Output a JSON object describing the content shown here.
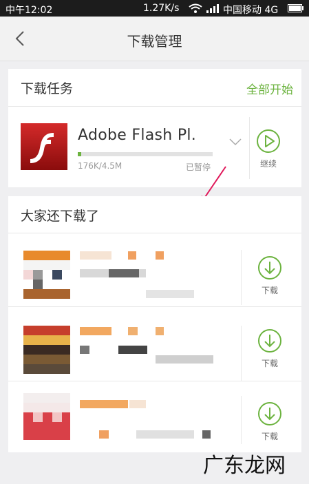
{
  "status_bar": {
    "time": "中午12:02",
    "speed": "1.27K/s",
    "carrier": "中国移动 4G"
  },
  "nav": {
    "title": "下载管理"
  },
  "tasks": {
    "title": "下载任务",
    "start_all": "全部开始",
    "item": {
      "name": "Adobe Flash Pl.",
      "size": "176K/4.5M",
      "status": "已暂停",
      "action": "继续",
      "progress": 0.023
    }
  },
  "recommend": {
    "title": "大家还下载了",
    "items": [
      {
        "action": "下载"
      },
      {
        "action": "下载"
      },
      {
        "action": "下载"
      }
    ]
  },
  "watermark": "广东龙网",
  "colors": {
    "accent": "#6cb33f",
    "annotation": "#e0185a"
  }
}
